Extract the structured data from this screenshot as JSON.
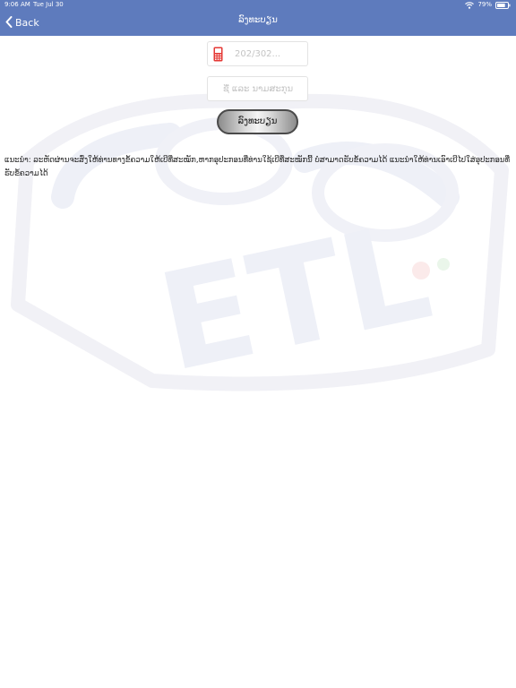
{
  "status_bar": {
    "time": "9:06 AM",
    "date": "Tue Jul 30",
    "battery_percent": "79%",
    "battery_level": 0.79,
    "icons": [
      "wifi-icon",
      "battery-icon"
    ]
  },
  "nav_bar": {
    "back_label": "Back",
    "title": "ລົງທະບຽນ",
    "background_color": "#5e7bbd",
    "back_icon": "chevron-left-icon"
  },
  "form": {
    "phone_placeholder": "202/302...",
    "phone_value": "",
    "phone_icon": "mobile-phone-icon",
    "name_placeholder": "ຊື່ ແລະ ນາມສະກຸນ",
    "name_value": "",
    "register_label": "ລົງທະບຽນ"
  },
  "note": {
    "text": "ແນະນຳ: ລະຫັດຜ່ານຈະສົ່ງໃຫ້ທ່ານທາງຂໍ້ຄວາມໃຫ້ເບີທີ່ສະໝັກ,ຫາກອຸປະກອນທີ່ທ່ານໃຊ້ເບີທີ່ສະໝັກນີ້ ບໍ່ສາມາດຮັບຂໍ້ຄວາມໄດ້ ແນະນຳໃຫ້ທ່ານເອົາເບີໄປໃສ່ອຸປະກອນທີ່ຮັບຂໍ້ຄວາມໄດ້"
  },
  "watermark": {
    "logo_text": "ETL"
  }
}
